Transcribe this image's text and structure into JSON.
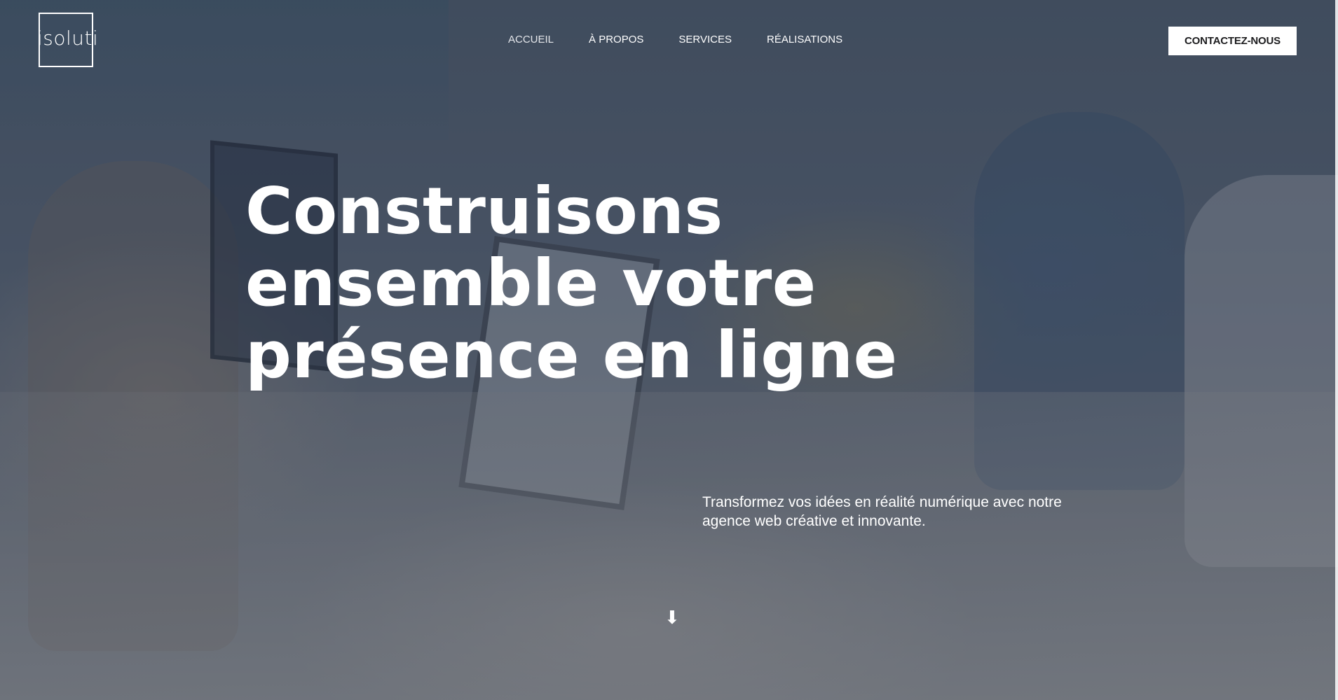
{
  "brand": {
    "logo_text": "isoluti"
  },
  "nav": {
    "items": [
      {
        "label": "ACCUEIL",
        "active": true
      },
      {
        "label": "À PROPOS",
        "active": false
      },
      {
        "label": "SERVICES",
        "active": false
      },
      {
        "label": "RÉALISATIONS",
        "active": false
      }
    ]
  },
  "header": {
    "cta_label": "CONTACTEZ-NOUS"
  },
  "hero": {
    "headline_lines": [
      "Construisons",
      "ensemble votre",
      "présence en ligne"
    ],
    "subtitle": "Transformez vos idées en réalité numérique avec notre agence web créative et innovante.",
    "scroll_icon": "arrow-down-icon"
  },
  "colors": {
    "overlay": "#1e283c",
    "text": "#ffffff",
    "cta_bg": "#ffffff",
    "cta_text": "#1d1d1f"
  }
}
